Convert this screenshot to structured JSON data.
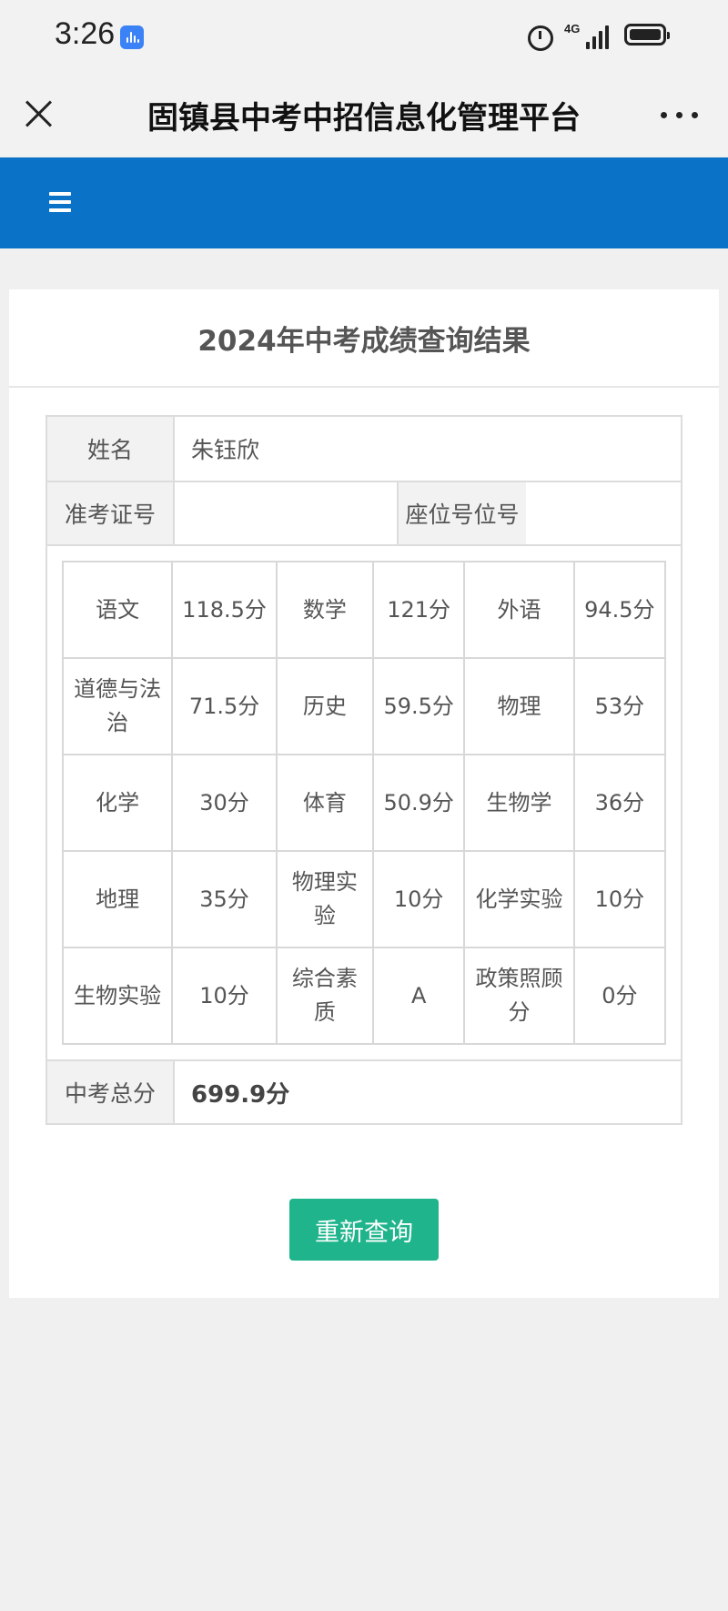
{
  "status_bar": {
    "time": "3:26",
    "network": "4G"
  },
  "title_bar": {
    "title": "固镇县中考中招信息化管理平台"
  },
  "card": {
    "title": "2024年中考成绩查询结果",
    "name_label": "姓名",
    "name_value": "朱钰欣",
    "exam_id_label": "准考证号",
    "exam_id_value": "",
    "seat_label": "座位号位号",
    "seat_value": "",
    "scores": [
      [
        {
          "subject": "语文",
          "score": "118.5分"
        },
        {
          "subject": "数学",
          "score": "121分"
        },
        {
          "subject": "外语",
          "score": "94.5分"
        }
      ],
      [
        {
          "subject": "道德与法治",
          "score": "71.5分"
        },
        {
          "subject": "历史",
          "score": "59.5分"
        },
        {
          "subject": "物理",
          "score": "53分"
        }
      ],
      [
        {
          "subject": "化学",
          "score": "30分"
        },
        {
          "subject": "体育",
          "score": "50.9分"
        },
        {
          "subject": "生物学",
          "score": "36分"
        }
      ],
      [
        {
          "subject": "地理",
          "score": "35分"
        },
        {
          "subject": "物理实验",
          "score": "10分"
        },
        {
          "subject": "化学实验",
          "score": "10分"
        }
      ],
      [
        {
          "subject": "生物实验",
          "score": "10分"
        },
        {
          "subject": "综合素质",
          "score": "A"
        },
        {
          "subject": "政策照顾分",
          "score": "0分"
        }
      ]
    ],
    "total_label": "中考总分",
    "total_value": "699.9分",
    "requery_label": "重新查询"
  },
  "colors": {
    "nav_blue": "#0b73c7",
    "button_green": "#1fb48c"
  }
}
